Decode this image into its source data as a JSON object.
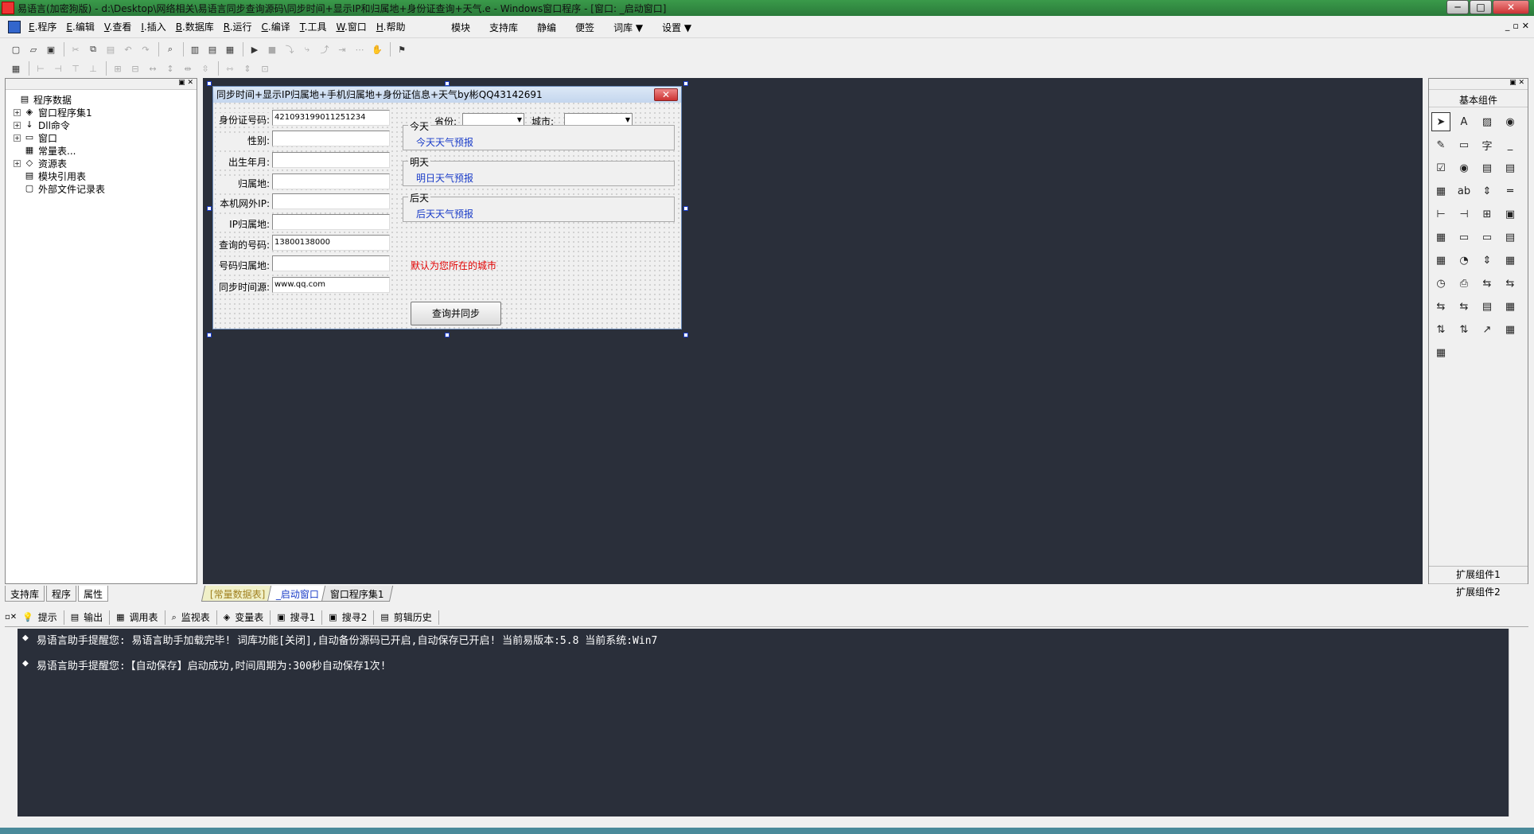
{
  "window": {
    "title": "易语言(加密狗版) - d:\\Desktop\\网络相关\\易语言同步查询源码\\同步时间+显示IP和归属地+身份证查询+天气.e - Windows窗口程序 - [窗口: _启动窗口]",
    "btn_min": "─",
    "btn_max": "□",
    "btn_close": "✕"
  },
  "menu": {
    "items": [
      {
        "key": "E",
        "label": ".程序"
      },
      {
        "key": "E",
        "label": ".编辑"
      },
      {
        "key": "V",
        "label": ".查看"
      },
      {
        "key": "I",
        "label": ".插入"
      },
      {
        "key": "B",
        "label": ".数据库"
      },
      {
        "key": "R",
        "label": ".运行"
      },
      {
        "key": "C",
        "label": ".编译"
      },
      {
        "key": "T",
        "label": ".工具"
      },
      {
        "key": "W",
        "label": ".窗口"
      },
      {
        "key": "H",
        "label": ".帮助"
      }
    ],
    "right": [
      "模块",
      "支持库",
      "静编",
      "便签",
      "词库 ▼",
      "设置 ▼"
    ],
    "mdi_min": "_",
    "mdi_restore": "▫",
    "mdi_close": "✕"
  },
  "left_panel": {
    "pin": "▣ ✕",
    "tree": [
      {
        "expander": "",
        "icon": "▤",
        "label": "程序数据",
        "indent": 0
      },
      {
        "expander": "+",
        "icon": "◈",
        "label": "窗口程序集1",
        "indent": 1
      },
      {
        "expander": "+",
        "icon": "↓",
        "label": "Dll命令",
        "indent": 1
      },
      {
        "expander": "+",
        "icon": "▭",
        "label": "窗口",
        "indent": 1
      },
      {
        "expander": "",
        "icon": "▦",
        "label": "常量表...",
        "indent": 1
      },
      {
        "expander": "+",
        "icon": "◇",
        "label": "资源表",
        "indent": 1
      },
      {
        "expander": "",
        "icon": "▤",
        "label": "模块引用表",
        "indent": 1
      },
      {
        "expander": "",
        "icon": "▢",
        "label": "外部文件记录表",
        "indent": 1
      }
    ],
    "tabs": [
      "支持库",
      "程序",
      "属性"
    ]
  },
  "form": {
    "title": "同步时间+显示IP归属地+手机归属地+身份证信息+天气by彬QQ43142691",
    "close": "✕",
    "province_label": "省份:",
    "city_label": "城市:",
    "fields": [
      {
        "label": "身份证号码:",
        "value": "421093199011251234"
      },
      {
        "label": "性别:",
        "value": ""
      },
      {
        "label": "出生年月:",
        "value": ""
      },
      {
        "label": "归属地:",
        "value": ""
      },
      {
        "label": "本机网外IP:",
        "value": ""
      },
      {
        "label": "IP归属地:",
        "value": ""
      },
      {
        "label": "查询的号码:",
        "value": "13800138000"
      },
      {
        "label": "号码归属地:",
        "value": ""
      },
      {
        "label": "同步时间源:",
        "value": "www.qq.com"
      }
    ],
    "groups": [
      {
        "title": "今天",
        "value": "今天天气预报"
      },
      {
        "title": "明天",
        "value": "明日天气预报"
      },
      {
        "title": "后天",
        "value": "后天天气预报"
      }
    ],
    "note": "默认为您所在的城市",
    "note_color": "#e00000",
    "button": "查询并同步"
  },
  "right_panel": {
    "pin": "▣ ✕",
    "title": "基本组件",
    "components": [
      "➤",
      "A",
      "▨",
      "◉",
      "✎",
      "▭",
      "字",
      "_",
      "☑",
      "◉",
      "▤",
      "▤",
      "▦",
      "ab",
      "⇕",
      "═",
      "⊢",
      "⊣",
      "⊞",
      "▣",
      "▦",
      "▭",
      "▭",
      "▤",
      "▦",
      "◔",
      "⇕",
      "▦",
      "◷",
      "⎙",
      "⇆",
      "⇆",
      "⇆",
      "⇆",
      "▤",
      "▦",
      "⇅",
      "⇅",
      "↗",
      "▦",
      "▦"
    ],
    "ext1": "扩展组件1",
    "ext2": "扩展组件2"
  },
  "design_tabs": [
    "[常量数据表]",
    "_启动窗口",
    "窗口程序集1"
  ],
  "bottom_tabs": [
    {
      "icon": "💡",
      "label": "提示"
    },
    {
      "icon": "▤",
      "label": "输出"
    },
    {
      "icon": "▦",
      "label": "调用表"
    },
    {
      "icon": "⌕",
      "label": "监视表"
    },
    {
      "icon": "◈",
      "label": "变量表"
    },
    {
      "icon": "▣",
      "label": "搜寻1"
    },
    {
      "icon": "▣",
      "label": "搜寻2"
    },
    {
      "icon": "▤",
      "label": "剪辑历史"
    }
  ],
  "output": [
    "易语言助手提醒您:  易语言助手加载完毕!  词库功能[关闭],自动备份源码已开启,自动保存已开启!  当前易版本:5.8  当前系统:Win7",
    "易语言助手提醒您:【自动保存】启动成功,时间周期为:300秒自动保存1次!"
  ],
  "output_bullet": "◆"
}
